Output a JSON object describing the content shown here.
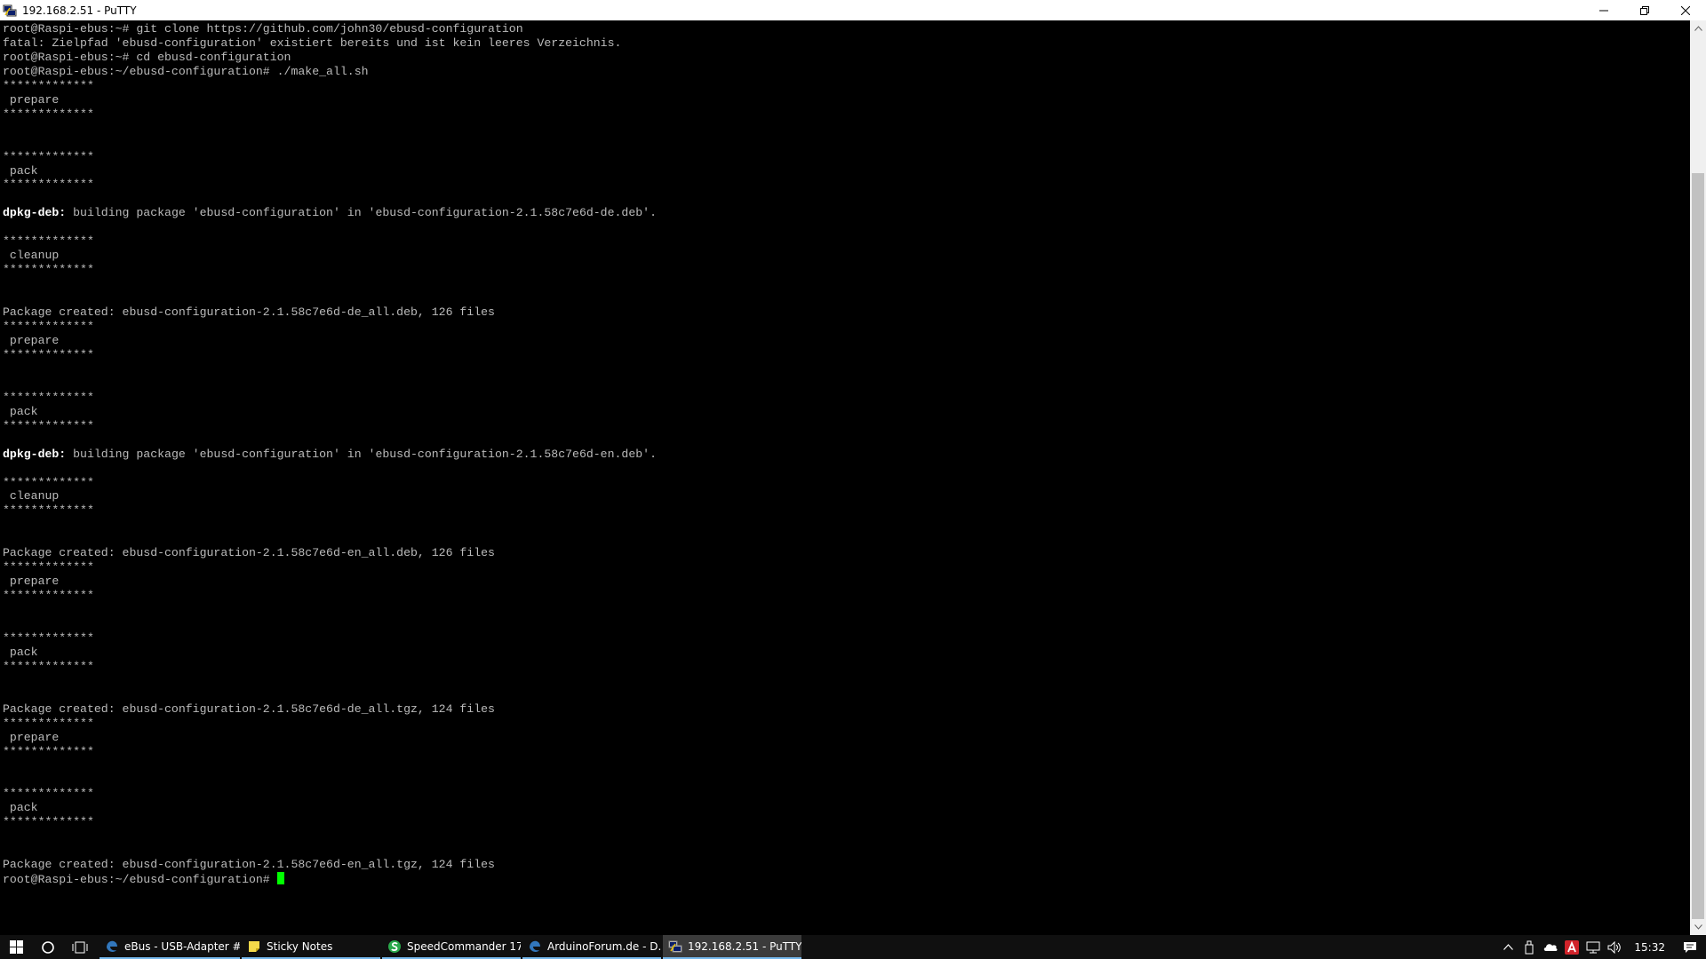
{
  "window": {
    "title": "192.168.2.51 - PuTTY"
  },
  "terminal": {
    "lines": [
      "root@Raspi-ebus:~# git clone https://github.com/john30/ebusd-configuration",
      "fatal: Zielpfad 'ebusd-configuration' existiert bereits und ist kein leeres Verzeichnis.",
      "root@Raspi-ebus:~# cd ebusd-configuration",
      "root@Raspi-ebus:~/ebusd-configuration# ./make_all.sh",
      "*************",
      " prepare",
      "*************",
      "",
      "",
      "*************",
      " pack",
      "*************",
      "",
      "dpkg-deb: building package 'ebusd-configuration' in 'ebusd-configuration-2.1.58c7e6d-de.deb'.",
      "",
      "*************",
      " cleanup",
      "*************",
      "",
      "",
      "Package created: ebusd-configuration-2.1.58c7e6d-de_all.deb, 126 files",
      "*************",
      " prepare",
      "*************",
      "",
      "",
      "*************",
      " pack",
      "*************",
      "",
      "dpkg-deb: building package 'ebusd-configuration' in 'ebusd-configuration-2.1.58c7e6d-en.deb'.",
      "",
      "*************",
      " cleanup",
      "*************",
      "",
      "",
      "Package created: ebusd-configuration-2.1.58c7e6d-en_all.deb, 126 files",
      "*************",
      " prepare",
      "*************",
      "",
      "",
      "*************",
      " pack",
      "*************",
      "",
      "",
      "Package created: ebusd-configuration-2.1.58c7e6d-de_all.tgz, 124 files",
      "*************",
      " prepare",
      "*************",
      "",
      "",
      "*************",
      " pack",
      "*************",
      "",
      "",
      "Package created: ebusd-configuration-2.1.58c7e6d-en_all.tgz, 124 files",
      "root@Raspi-ebus:~/ebusd-configuration# "
    ],
    "bold_prefix": "dpkg-deb:",
    "cursor_color": "#00ff00",
    "text_color": "#bbbbbb",
    "background": "#000000"
  },
  "taskbar": {
    "apps": [
      {
        "label": "eBus - USB-Adapter #...",
        "icon": "edge-icon"
      },
      {
        "label": "Sticky Notes",
        "icon": "sticky-notes-icon"
      },
      {
        "label": "SpeedCommander 17....",
        "icon": "speedcommander-icon"
      },
      {
        "label": "ArduinoForum.de - D...",
        "icon": "edge-icon"
      },
      {
        "label": "192.168.2.51 - PuTTY",
        "icon": "putty-icon"
      }
    ],
    "clock": "15:32"
  },
  "colors": {
    "accent": "#76b9ed",
    "taskbar": "#101010"
  }
}
